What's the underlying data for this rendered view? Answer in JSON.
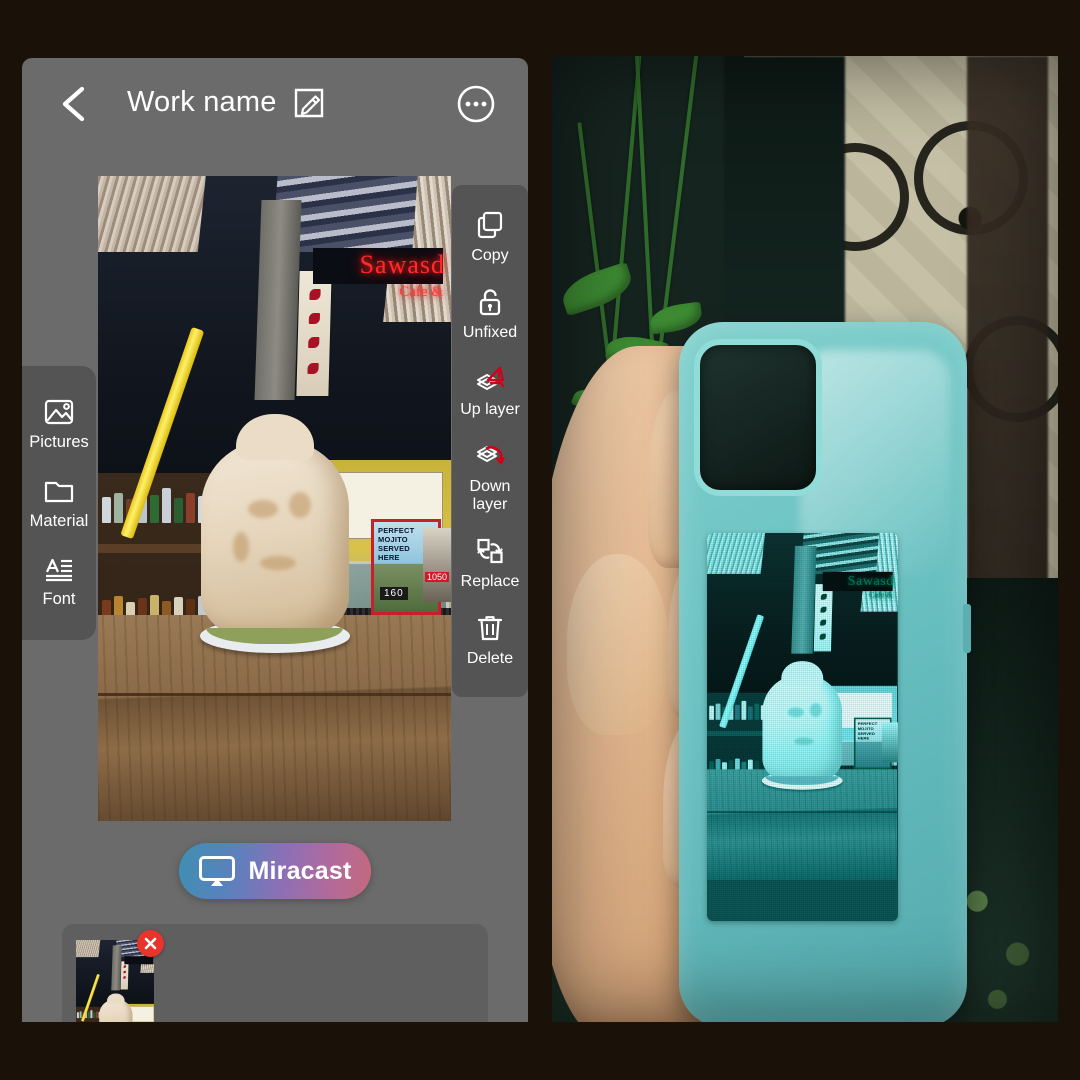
{
  "app": {
    "background_color": "#1a1208",
    "panel_color": "#6b6b6b",
    "toolbar_color": "#545454"
  },
  "header": {
    "back_icon": "back-chevron-icon",
    "title": "Work name",
    "edit_icon": "edit-pencil-icon",
    "more_icon": "more-options-icon"
  },
  "sidebar": {
    "items": [
      {
        "label": "Pictures",
        "icon": "image-icon"
      },
      {
        "label": "Material",
        "icon": "folder-icon"
      },
      {
        "label": "Font",
        "icon": "text-font-icon"
      }
    ]
  },
  "context_toolbar": {
    "items": [
      {
        "label": "Copy",
        "icon": "copy-icon"
      },
      {
        "label": "Unfixed",
        "icon": "unlock-icon"
      },
      {
        "label": "Up layer",
        "icon": "layer-up-icon",
        "accent": "#d0021b"
      },
      {
        "label": "Down layer",
        "icon": "layer-down-icon",
        "accent": "#d0021b"
      },
      {
        "label": "Replace",
        "icon": "replace-swap-icon"
      },
      {
        "label": "Delete",
        "icon": "trash-icon"
      }
    ]
  },
  "miracast": {
    "label": "Miracast",
    "icon": "cast-screen-icon",
    "gradient_start": "#3e8fb2",
    "gradient_mid": "#8e6fb5",
    "gradient_end": "#c4697c"
  },
  "tray": {
    "delete_badge_icon": "close-x-icon",
    "delete_badge_color": "#e8352b"
  },
  "canvas_photo": {
    "description": "Coconut drink with yellow straw on white plate at a wooden bar counter",
    "neon_sign_line1": "Sawasd",
    "neon_sign_line2": "Cafe &",
    "poster_text": "PERFECT\nMOJITO\nSERVED\nHERE",
    "poster_price": "160",
    "poster2_price": "1050"
  },
  "product_photo": {
    "description": "Hand holding a mint-teal phone case with a custom printed photo",
    "case_color": "#6ec4c4",
    "camera_cutout": "camera-cutout"
  }
}
